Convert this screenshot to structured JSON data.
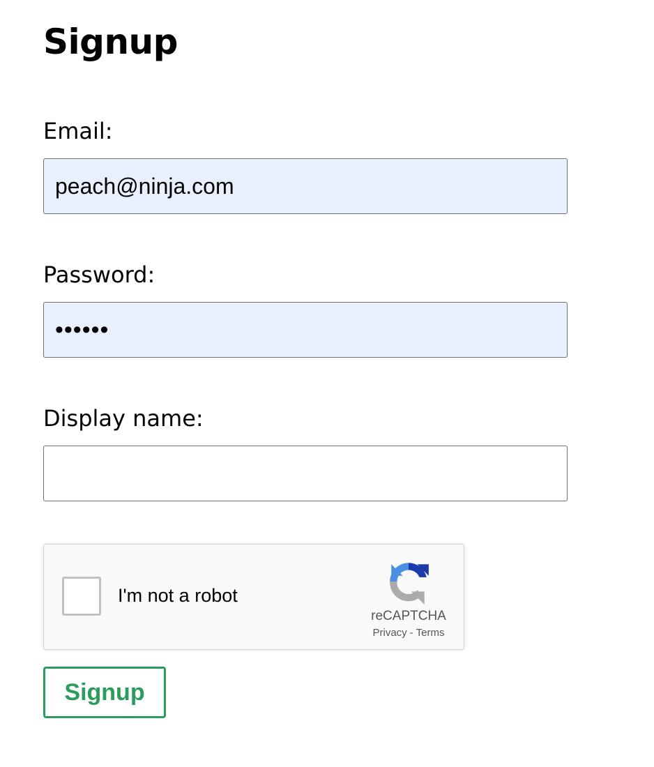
{
  "page": {
    "title": "Signup"
  },
  "form": {
    "email": {
      "label": "Email:",
      "value": "peach@ninja.com"
    },
    "password": {
      "label": "Password:",
      "value": "123456"
    },
    "display_name": {
      "label": "Display name:",
      "value": ""
    },
    "submit_label": "Signup"
  },
  "recaptcha": {
    "checkbox_label": "I'm not a robot",
    "brand": "reCAPTCHA",
    "privacy_link": "Privacy",
    "separator": "-",
    "terms_link": "Terms",
    "logo_icon": "recaptcha-logo-icon"
  },
  "colors": {
    "autofill_bg": "#e8f0fe",
    "button_accent": "#2a9d5c",
    "field_border": "#6f6f6f"
  }
}
